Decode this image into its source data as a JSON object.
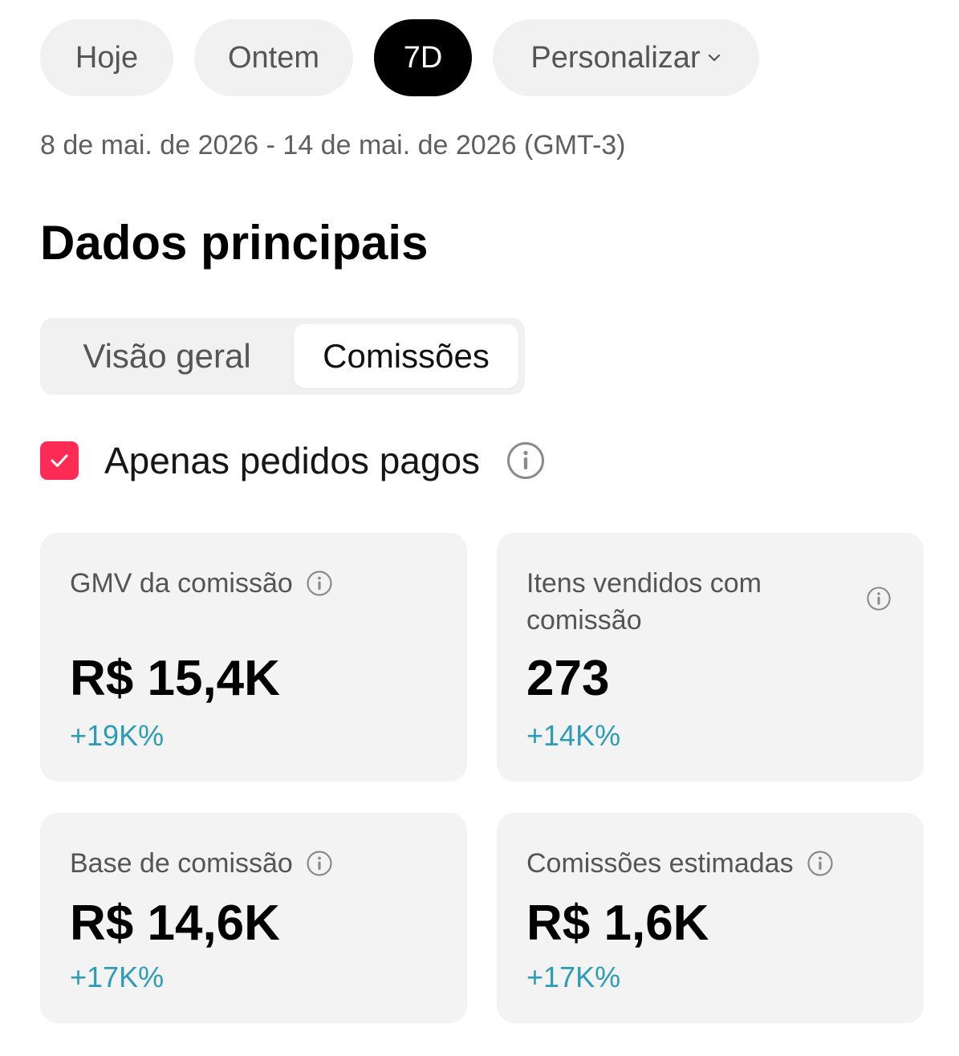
{
  "filters": {
    "chips": [
      {
        "label": "Hoje",
        "selected": false
      },
      {
        "label": "Ontem",
        "selected": false
      },
      {
        "label": "7D",
        "selected": true
      },
      {
        "label": "Personalizar",
        "selected": false,
        "icon": "chevron-down-icon"
      }
    ],
    "date_range": "8 de mai. de 2026 - 14 de mai. de 2026 (GMT-3)"
  },
  "section": {
    "title": "Dados principais"
  },
  "tabs": [
    {
      "label": "Visão geral",
      "selected": false
    },
    {
      "label": "Comissões",
      "selected": true
    }
  ],
  "paid_only": {
    "label": "Apenas pedidos pagos",
    "checked": true,
    "icon": "info-icon"
  },
  "metrics": [
    {
      "label": "GMV da comissão",
      "value": "R$ 15,4K",
      "delta": "+19K%"
    },
    {
      "label": "Itens vendidos com comissão",
      "value": "273",
      "delta": "+14K%"
    },
    {
      "label": "Base de comissão",
      "value": "R$ 14,6K",
      "delta": "+17K%"
    },
    {
      "label": "Comissões estimadas",
      "value": "R$ 1,6K",
      "delta": "+17K%"
    }
  ],
  "colors": {
    "accent": "#fe2c55",
    "positive_delta": "#2c9cb7",
    "selected_chip": "#000000",
    "card_bg": "#f3f3f3"
  }
}
